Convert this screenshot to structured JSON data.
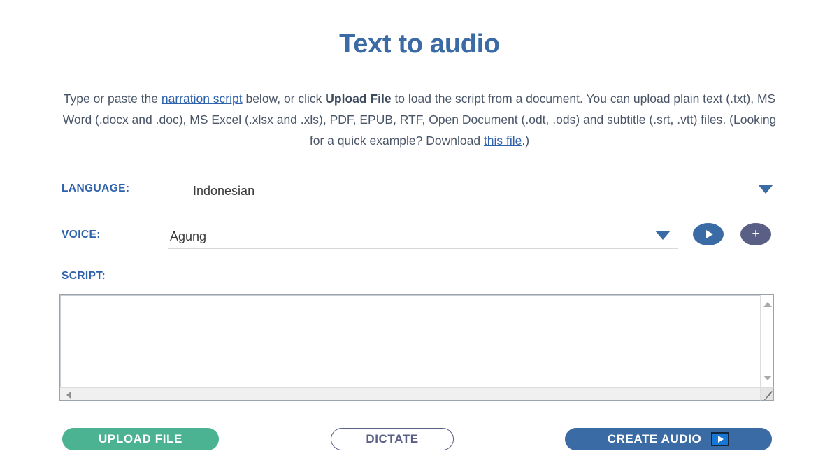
{
  "page": {
    "title": "Text to audio",
    "title_color": "#3a6ba5",
    "background": "#ffffff"
  },
  "description": {
    "line1_part1": "Type or paste the ",
    "line1_link": "narration script",
    "line1_part2": " below, or click ",
    "line1_strong": "Upload File",
    "line1_part3": " to load the script from a document. You",
    "line2": "can upload plain text (.txt), MS Word (.docx and .doc), MS Excel (.xlsx and .xls), PDF, EPUB, RTF,",
    "line3": "Open Document (.odt, .ods) and subtitle (.srt, .vtt) files.",
    "line4_part1": "(Looking for a quick example? Download ",
    "line4_link": "this file",
    "line4_part2": ".)"
  },
  "fields": {
    "language": {
      "label": "LANGUAGE:",
      "value": "Indonesian",
      "caret_icon": "chevron-down-icon",
      "caret_color": "#3a6ba5"
    },
    "voice": {
      "label": "VOICE:",
      "value": "Agung",
      "caret_icon": "chevron-down-icon",
      "caret_color": "#3a6ba5"
    },
    "script": {
      "label": "SCRIPT:",
      "value": "",
      "placeholder": ""
    }
  },
  "voice_actions": {
    "preview": {
      "icon": "play-icon",
      "color": "#3a6ba5"
    },
    "add": {
      "icon": "plus-icon",
      "label": "+",
      "color": "#5a5f85"
    }
  },
  "buttons": {
    "upload_file": {
      "label": "UPLOAD FILE",
      "color": "#4bb391",
      "text_color": "#ffffff"
    },
    "dictate": {
      "label": "DICTATE",
      "border_color": "#5a5f85",
      "text_color": "#5a5f85"
    },
    "create_audio": {
      "label": "CREATE AUDIO",
      "color": "#3a6ba5",
      "text_color": "#ffffff",
      "icon": "play-icon",
      "icon_color": "#1877d2"
    }
  },
  "scrollbars": {
    "vertical": {
      "up_icon": "arrow-up-icon",
      "down_icon": "arrow-down-icon"
    },
    "horizontal": {
      "left_icon": "arrow-left-icon"
    },
    "resize_handle": "resize-grip-icon"
  }
}
